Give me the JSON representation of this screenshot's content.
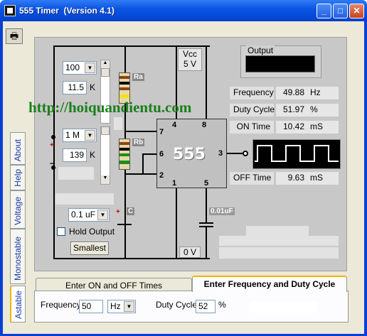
{
  "window": {
    "title": "555 Timer  (Version 4.1)",
    "minimize_glyph": "_",
    "maximize_glyph": "□",
    "close_glyph": "✕"
  },
  "print_icon": "🖶",
  "side_tabs": [
    "Astable",
    "Monostable",
    "Voltage",
    "Help",
    "About"
  ],
  "controls": {
    "ra_value": "100",
    "ra_multiplier": "11.5",
    "ra_unit": "K",
    "rb_value": "1 M",
    "rb_multiplier": "139",
    "rb_unit": "K",
    "ra_label": "Ra",
    "rb_label": "Rb",
    "c_label": "C",
    "cap_select": "0.1 uF",
    "hold_output": "Hold Output",
    "smallest": "Smallest",
    "plus_sign": "+",
    "minus_sign": "−"
  },
  "circuit": {
    "chip_name": "555",
    "pins": [
      "4",
      "8",
      "7",
      "6",
      "3",
      "2",
      "1",
      "5"
    ],
    "vcc_label": "Vcc",
    "vcc_value": "5 V",
    "gnd_value": "0 V",
    "cap_001": "0.01uF"
  },
  "output": {
    "label": "Output"
  },
  "readouts": {
    "frequency": {
      "label": "Frequency",
      "value": "49.88",
      "unit": "Hz"
    },
    "duty_cycle": {
      "label": "Duty Cycle",
      "value": "51.97",
      "unit": "%"
    },
    "on_time": {
      "label": "ON Time",
      "value": "10.42",
      "unit": "mS"
    },
    "off_time": {
      "label": "OFF Time",
      "value": "9.63",
      "unit": "mS"
    }
  },
  "watermark": "http://hoiquandientu.com",
  "bottom_tabs": {
    "tab1": "Enter ON and OFF Times",
    "tab2": "Enter Frequency and Duty Cycle"
  },
  "bottom_inputs": {
    "frequency_label": "Frequency",
    "frequency_value": "50",
    "frequency_unit": "Hz",
    "duty_label": "Duty Cycle",
    "duty_value": "52",
    "duty_unit": "%"
  },
  "colors": {
    "title_bar": "#0b56e3",
    "panel": "#c8c8c8",
    "watermark": "#1a7f1a",
    "scope_bg": "#000000"
  }
}
